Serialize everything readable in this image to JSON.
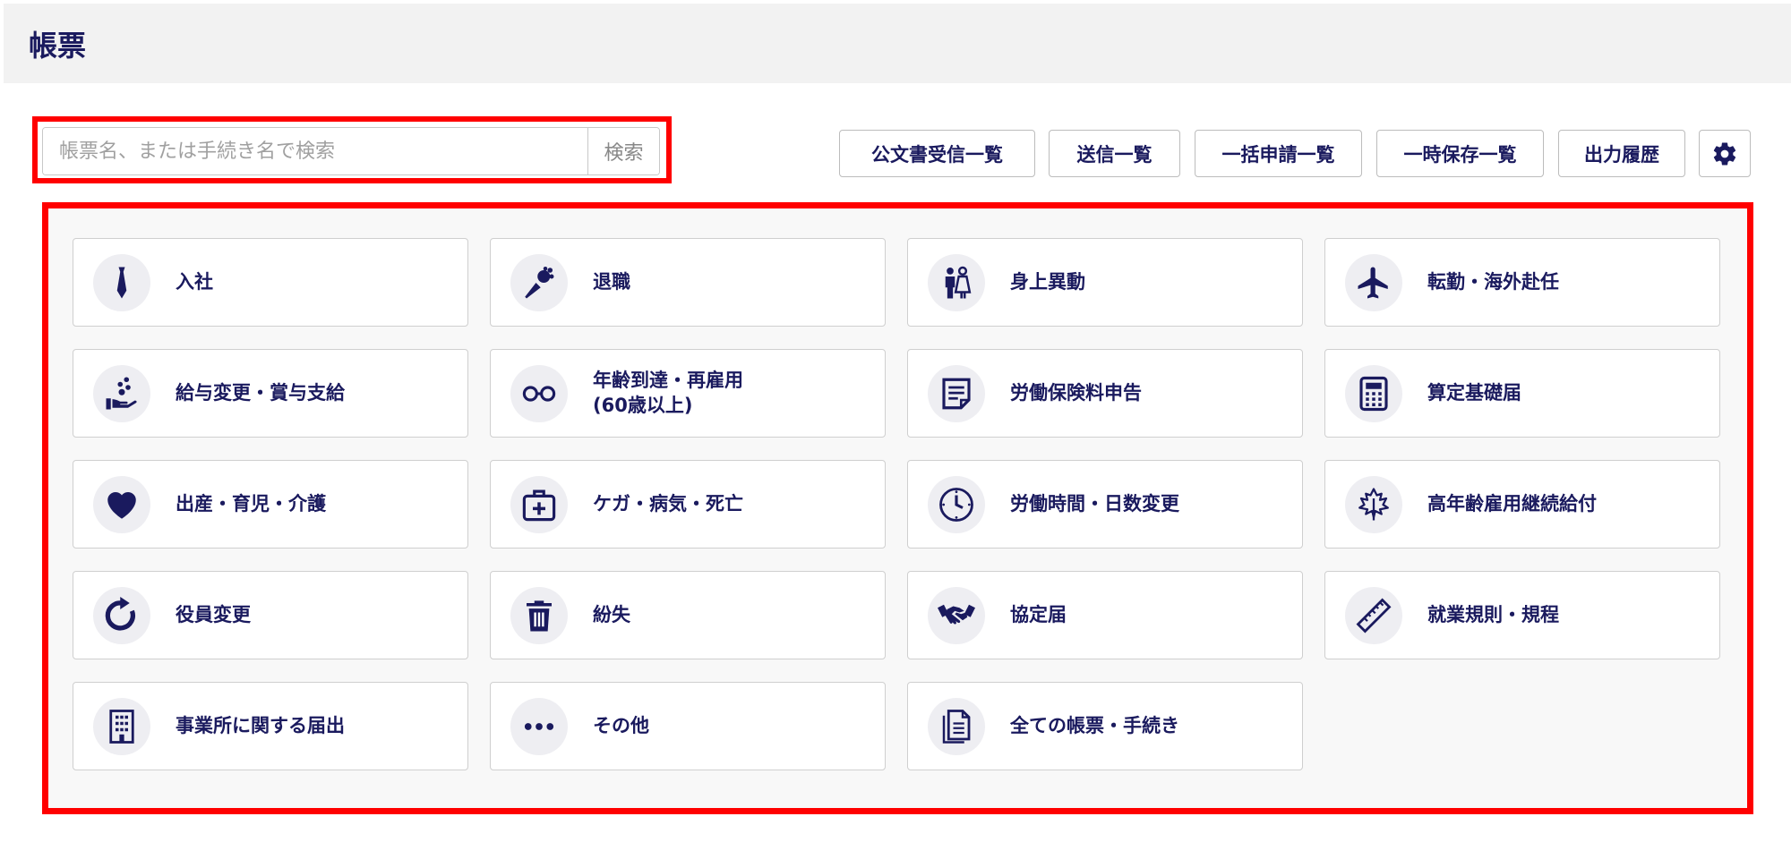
{
  "header": {
    "title": "帳票"
  },
  "search": {
    "placeholder": "帳票名、または手続き名で検索",
    "button_label": "検索"
  },
  "toolbar": {
    "buttons": [
      {
        "label": "公文書受信一覧"
      },
      {
        "label": "送信一覧"
      },
      {
        "label": "一括申請一覧"
      },
      {
        "label": "一時保存一覧"
      },
      {
        "label": "出力履歴"
      }
    ],
    "settings_icon": "gear-icon"
  },
  "tiles": [
    {
      "label": "入社",
      "icon": "necktie-icon"
    },
    {
      "label": "退職",
      "icon": "bouquet-icon"
    },
    {
      "label": "身上異動",
      "icon": "couple-icon"
    },
    {
      "label": "転勤・海外赴任",
      "icon": "airplane-icon"
    },
    {
      "label": "給与変更・賞与支給",
      "icon": "hand-coins-icon"
    },
    {
      "label": "年齢到達・再雇用\n(60歳以上)",
      "icon": "glasses-icon"
    },
    {
      "label": "労働保険料申告",
      "icon": "document-icon"
    },
    {
      "label": "算定基礎届",
      "icon": "calculator-icon"
    },
    {
      "label": "出産・育児・介護",
      "icon": "heart-icon"
    },
    {
      "label": "ケガ・病気・死亡",
      "icon": "first-aid-icon"
    },
    {
      "label": "労働時間・日数変更",
      "icon": "clock-icon"
    },
    {
      "label": "高年齢雇用継続給付",
      "icon": "maple-leaf-icon"
    },
    {
      "label": "役員変更",
      "icon": "refresh-icon"
    },
    {
      "label": "紛失",
      "icon": "trash-icon"
    },
    {
      "label": "協定届",
      "icon": "handshake-icon"
    },
    {
      "label": "就業規則・規程",
      "icon": "ruler-icon"
    },
    {
      "label": "事業所に関する届出",
      "icon": "building-icon"
    },
    {
      "label": "その他",
      "icon": "ellipsis-icon"
    },
    {
      "label": "全ての帳票・手続き",
      "icon": "documents-icon"
    }
  ]
}
